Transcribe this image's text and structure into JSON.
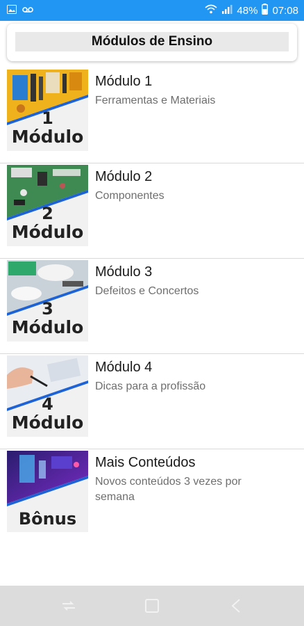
{
  "status_bar": {
    "battery": "48%",
    "time": "07:08",
    "left_icons": [
      "image-icon",
      "voicemail-icon"
    ],
    "right_icons": [
      "wifi-icon",
      "signal-icon",
      "battery-icon"
    ]
  },
  "header": {
    "title": "Módulos de Ensino"
  },
  "modules": [
    {
      "title": "Módulo 1",
      "subtitle": "Ferramentas e Materiais",
      "thumb_number": "1",
      "thumb_label": "Módulo"
    },
    {
      "title": "Módulo 2",
      "subtitle": "Componentes",
      "thumb_number": "2",
      "thumb_label": "Módulo"
    },
    {
      "title": "Módulo 3",
      "subtitle": "Defeitos e Concertos",
      "thumb_number": "3",
      "thumb_label": "Módulo"
    },
    {
      "title": "Módulo 4",
      "subtitle": "Dicas para a profissão",
      "thumb_number": "4",
      "thumb_label": "Módulo"
    },
    {
      "title": "Mais Conteúdos",
      "subtitle": "Novos conteúdos 3 vezes por semana",
      "thumb_label": "Bônus"
    }
  ],
  "nav_bar": {
    "buttons": [
      "recents-icon",
      "home-icon",
      "back-icon"
    ]
  },
  "colors": {
    "status_bar": "#2196f3",
    "accent_stripe": "#1e63d6",
    "nav_bar": "#dcdcdc"
  }
}
